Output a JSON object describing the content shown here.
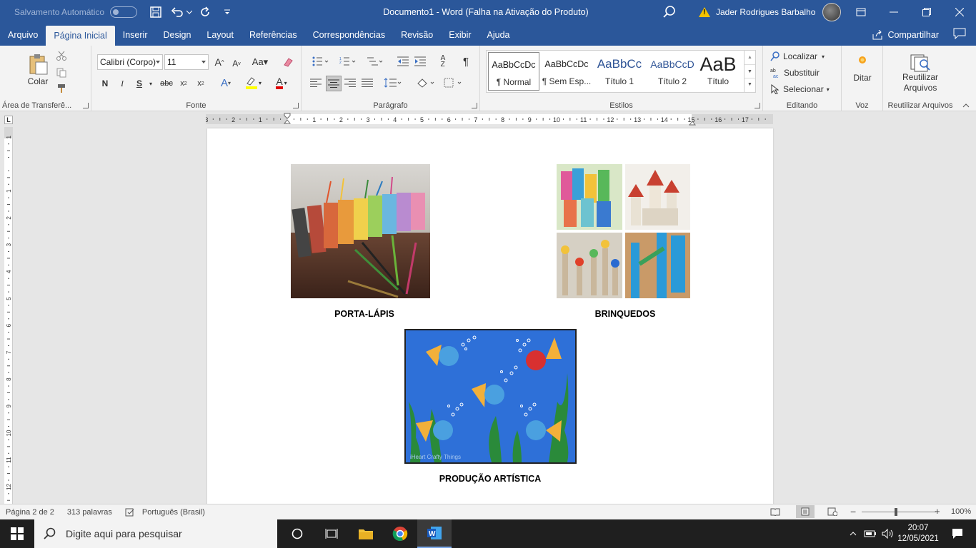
{
  "titlebar": {
    "autosave_label": "Salvamento Automático",
    "doc_title": "Documento1  -  Word (Falha na Ativação do Produto)",
    "user_name": "Jader Rodrigues Barbalho"
  },
  "tabs": [
    "Arquivo",
    "Página Inicial",
    "Inserir",
    "Design",
    "Layout",
    "Referências",
    "Correspondências",
    "Revisão",
    "Exibir",
    "Ajuda"
  ],
  "share_label": "Compartilhar",
  "ribbon": {
    "clipboard": {
      "paste_label": "Colar",
      "group_label": "Área de Transferê..."
    },
    "font": {
      "font_name": "Calibri (Corpo)",
      "font_size": "11",
      "group_label": "Fonte",
      "bold": "N",
      "italic": "I",
      "underline": "S"
    },
    "paragraph": {
      "group_label": "Parágrafo"
    },
    "styles": {
      "group_label": "Estilos",
      "items": [
        {
          "preview": "AaBbCcDc",
          "name": "¶ Normal"
        },
        {
          "preview": "AaBbCcDc",
          "name": "¶ Sem Esp..."
        },
        {
          "preview": "AaBbCc",
          "name": "Título 1"
        },
        {
          "preview": "AaBbCcD",
          "name": "Título 2"
        },
        {
          "preview": "AaB",
          "name": "Título"
        }
      ]
    },
    "editing": {
      "find": "Localizar",
      "replace": "Substituir",
      "select": "Selecionar",
      "group_label": "Editando"
    },
    "voice": {
      "dictate": "Ditar",
      "group_label": "Voz"
    },
    "reuse": {
      "button": "Reutilizar Arquivos",
      "group_label": "Reutilizar Arquivos"
    }
  },
  "ruler": {
    "numbers": [
      "3",
      "2",
      "1",
      "1",
      "2",
      "3",
      "4",
      "5",
      "6",
      "7",
      "8",
      "9",
      "10",
      "11",
      "12",
      "13",
      "14",
      "15",
      "16",
      "17"
    ]
  },
  "vruler": {
    "numbers": [
      "1",
      "1",
      "2",
      "3",
      "4",
      "5",
      "6",
      "7",
      "8",
      "9",
      "10",
      "11",
      "12"
    ]
  },
  "document": {
    "captions": {
      "pencil": "PORTA-LÁPIS",
      "toys": "BRINQUEDOS",
      "art": "PRODUÇÃO ARTÍSTICA"
    },
    "art_watermark": "iHeart Crafty Things"
  },
  "status": {
    "page": "Página 2 de 2",
    "words": "313 palavras",
    "language": "Português (Brasil)",
    "zoom": "100%"
  },
  "taskbar": {
    "search_placeholder": "Digite aqui para pesquisar",
    "time": "20:07",
    "date": "12/05/2021"
  }
}
